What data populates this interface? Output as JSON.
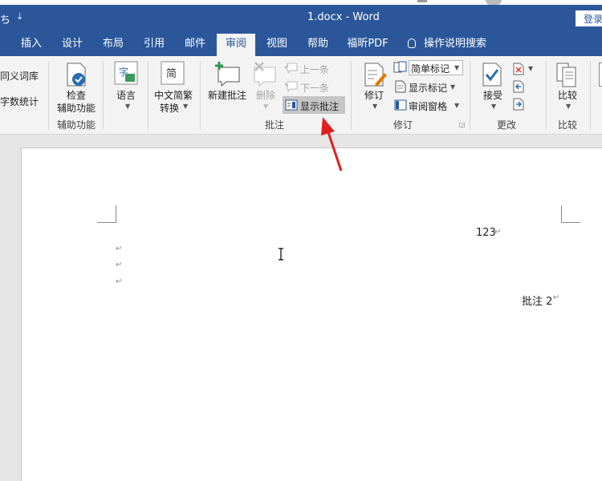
{
  "titlebar": {
    "left_fragment": "ち",
    "qat_dropdown": "⇣",
    "title": "1.docx  -  Word",
    "login": "登录"
  },
  "tabs": [
    "插入",
    "设计",
    "布局",
    "引用",
    "邮件",
    "审阅",
    "视图",
    "帮助",
    "福昕PDF"
  ],
  "active_tab": "审阅",
  "tell_me": "操作说明搜索",
  "ribbon": {
    "proofing": {
      "thesaurus": "同义词库",
      "word_count": "字数统计"
    },
    "accessibility": {
      "check_line1": "检查",
      "check_line2": "辅助功能",
      "group": "辅助功能"
    },
    "language": {
      "label": "语言"
    },
    "chinese": {
      "line1": "中文简繁",
      "line2": "转换"
    },
    "comments": {
      "new_comment": "新建批注",
      "delete": "删除",
      "previous": "上一条",
      "next": "下一条",
      "show_comments": "显示批注",
      "group": "批注"
    },
    "tracking": {
      "track_changes": "修订",
      "markup_select": "简单标记",
      "show_markup": "显示标记",
      "reviewing_pane": "审阅窗格",
      "group": "修订"
    },
    "changes": {
      "accept": "接受",
      "group": "更改"
    },
    "compare": {
      "label": "比较",
      "group": "比较"
    }
  },
  "document": {
    "paragraph_mark": "↵",
    "line1": "123",
    "comment_text": "批注 2"
  },
  "colors": {
    "titlebar": "#2b579a",
    "ribbon": "#f3f3f3",
    "arrow": "#e02020"
  },
  "icons": [
    "new-comment-icon",
    "delete-comment-icon",
    "previous-comment-icon",
    "next-comment-icon",
    "show-comments-icon",
    "track-changes-icon",
    "accept-icon",
    "compare-icon",
    "accessibility-icon",
    "language-icon",
    "chinese-convert-icon",
    "lightbulb-icon"
  ]
}
